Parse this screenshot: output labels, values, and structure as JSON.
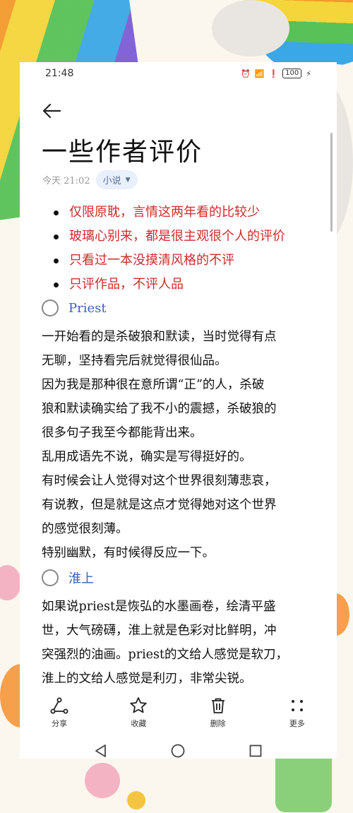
{
  "status_bar": {
    "time": "21:48",
    "battery": "100"
  },
  "note": {
    "title": "一些作者评价",
    "date": "今天 21:02",
    "category": "小说"
  },
  "bullets": [
    "仅限原耽，言情这两年看的比较少",
    "玻璃心别来，都是很主观很个人的评价",
    "只看过一本没摸清风格的不评",
    "只评作品，不评人品"
  ],
  "sections": [
    {
      "heading": "Priest",
      "lines": [
        "一开始看的是杀破狼和默读，当时觉得有点",
        "无聊，坚持看完后就觉得很仙品。",
        "因为我是那种很在意所谓“正”的人，杀破",
        "狼和默读确实给了我不小的震撼，杀破狼的",
        "很多句子我至今都能背出来。",
        "乱用成语先不说，确实是写得挺好的。",
        "有时候会让人觉得对这个世界很刻薄悲哀，",
        "有说教，但是就是这点才觉得她对这个世界",
        "的感觉很刻薄。",
        "特别幽默，有时候得反应一下。"
      ]
    },
    {
      "heading": "淮上",
      "lines": [
        "如果说priest是恢弘的水墨画卷，绘清平盛",
        "世，大气磅礴，淮上就是色彩对比鲜明，冲",
        "突强烈的油画。priest的文给人感觉是软刀，",
        "淮上的文给人感觉是利刃，非常尖锐。"
      ]
    }
  ],
  "toolbar": {
    "share": "分享",
    "favorite": "收藏",
    "delete": "删除",
    "more": "更多"
  },
  "colors": {
    "accent_red": "#d22a2a",
    "heading_blue": "#3a62b8"
  }
}
